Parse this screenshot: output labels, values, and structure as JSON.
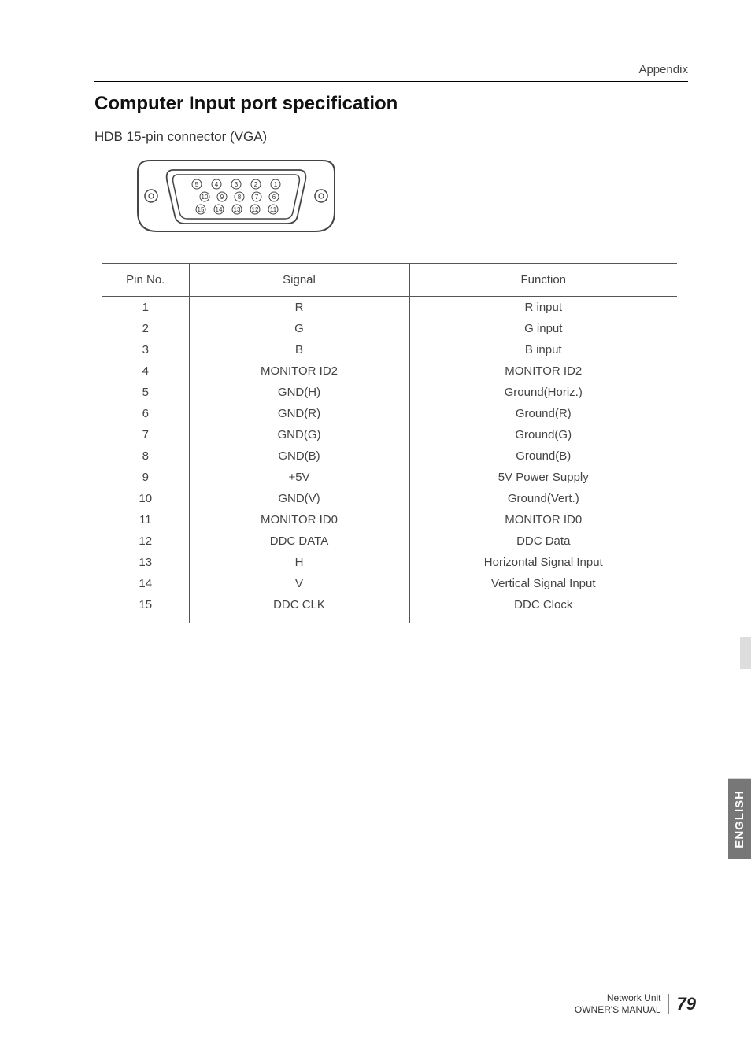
{
  "header": {
    "section": "Appendix"
  },
  "title": "Computer Input port specification",
  "subtitle": "HDB 15-pin connector (VGA)",
  "connector": {
    "pin_labels_row1": [
      "5",
      "4",
      "3",
      "2",
      "1"
    ],
    "pin_labels_row2": [
      "10",
      "9",
      "8",
      "7",
      "6"
    ],
    "pin_labels_row3": [
      "15",
      "14",
      "13",
      "12",
      "11"
    ]
  },
  "table": {
    "headers": [
      "Pin No.",
      "Signal",
      "Function"
    ],
    "rows": [
      {
        "pin": "1",
        "signal": "R",
        "function": "R input"
      },
      {
        "pin": "2",
        "signal": "G",
        "function": "G input"
      },
      {
        "pin": "3",
        "signal": "B",
        "function": "B input"
      },
      {
        "pin": "4",
        "signal": "MONITOR ID2",
        "function": "MONITOR ID2"
      },
      {
        "pin": "5",
        "signal": "GND(H)",
        "function": "Ground(Horiz.)"
      },
      {
        "pin": "6",
        "signal": "GND(R)",
        "function": "Ground(R)"
      },
      {
        "pin": "7",
        "signal": "GND(G)",
        "function": "Ground(G)"
      },
      {
        "pin": "8",
        "signal": "GND(B)",
        "function": "Ground(B)"
      },
      {
        "pin": "9",
        "signal": "+5V",
        "function": "5V Power Supply"
      },
      {
        "pin": "10",
        "signal": "GND(V)",
        "function": "Ground(Vert.)"
      },
      {
        "pin": "11",
        "signal": "MONITOR ID0",
        "function": "MONITOR ID0"
      },
      {
        "pin": "12",
        "signal": "DDC DATA",
        "function": "DDC Data"
      },
      {
        "pin": "13",
        "signal": "H",
        "function": "Horizontal Signal Input"
      },
      {
        "pin": "14",
        "signal": "V",
        "function": "Vertical Signal Input"
      },
      {
        "pin": "15",
        "signal": "DDC CLK",
        "function": "DDC Clock"
      }
    ]
  },
  "lang_tab": "ENGLISH",
  "footer": {
    "line1": "Network Unit",
    "line2": "OWNER'S MANUAL",
    "page_number": "79"
  }
}
